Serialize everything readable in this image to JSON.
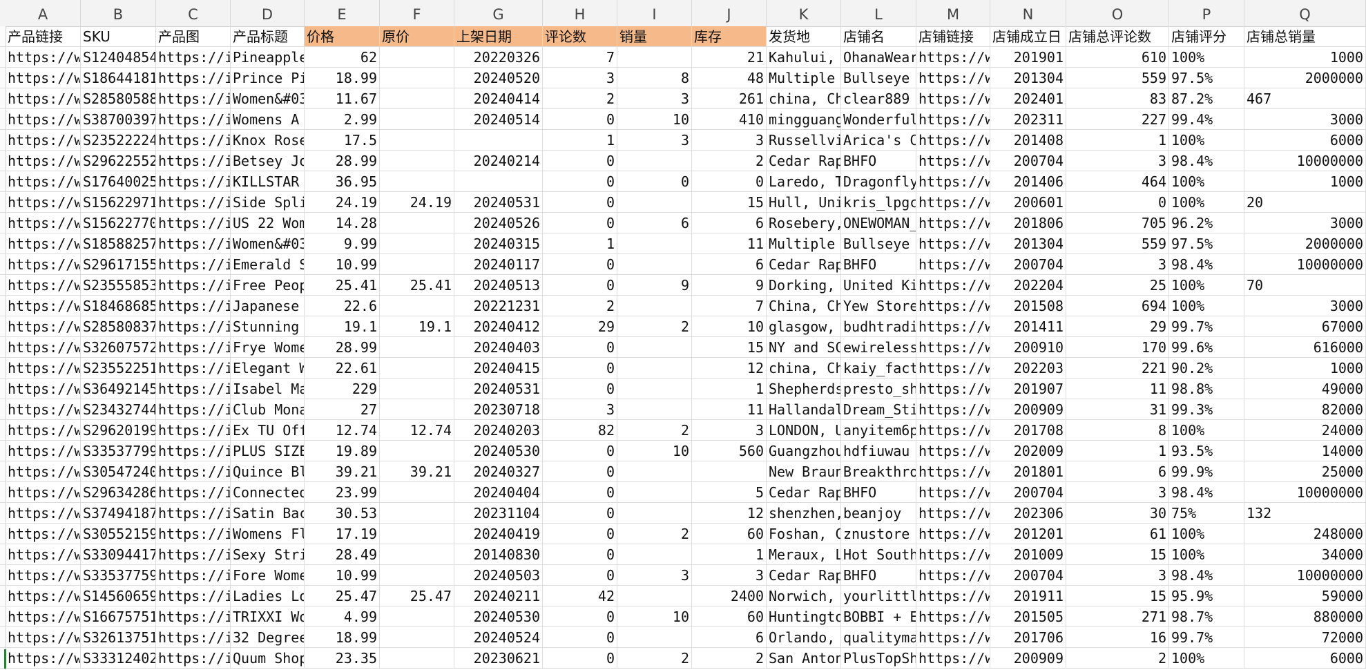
{
  "columns": [
    "A",
    "B",
    "C",
    "D",
    "E",
    "F",
    "G",
    "H",
    "I",
    "J",
    "K",
    "L",
    "M",
    "N",
    "O",
    "P",
    "Q"
  ],
  "header": [
    "产品链接",
    "SKU",
    "产品图",
    "产品标题",
    "价格",
    "原价",
    "上架日期",
    "评论数",
    "销量",
    "库存",
    "发货地",
    "店铺名",
    "店铺链接",
    "店铺成立日",
    "店铺总评论数",
    "店铺评分",
    "店铺总销量"
  ],
  "highlight_color": "#f6b98a",
  "rows": [
    [
      "https://w",
      "S12404854",
      "https://i",
      "Pineapple",
      "62",
      "",
      "20220326",
      "7",
      "",
      "21",
      "Kahului, ",
      "OhanaWear",
      "https://w",
      "201901",
      "610",
      "100%",
      "1000"
    ],
    [
      "https://w",
      "S18644181",
      "https://i",
      "Prince Pi",
      "18.99",
      "",
      "20240520",
      "3",
      "8",
      "48",
      "Multiple ",
      "Bullseye ",
      "https://w",
      "201304",
      "559",
      "97.5%",
      "2000000"
    ],
    [
      "https://w",
      "S28580588",
      "https://i",
      "Women&#03",
      "11.67",
      "",
      "20240414",
      "2",
      "3",
      "261",
      "china, Ch",
      "clear889 ",
      "https://w",
      "202401",
      "83",
      "87.2%",
      "467"
    ],
    [
      "https://w",
      "S38700397",
      "https://i",
      "Womens A ",
      "2.99",
      "",
      "20240514",
      "0",
      "10",
      "410",
      "mingguang",
      "Wonderful",
      "https://w",
      "202311",
      "227",
      "99.4%",
      "3000"
    ],
    [
      "https://w",
      "S23522224",
      "https://i",
      "Knox Rose",
      "17.5",
      "",
      "",
      "1",
      "3",
      "3",
      "Russellvi",
      "Arica's C",
      "https://w",
      "201408",
      "1",
      "100%",
      "6000"
    ],
    [
      "https://w",
      "S29622552",
      "https://i",
      "Betsey Jo",
      "28.99",
      "",
      "20240214",
      "0",
      "",
      "2",
      "Cedar Rap",
      "BHFO",
      "https://w",
      "200704",
      "3",
      "98.4%",
      "10000000"
    ],
    [
      "https://w",
      "S17640025",
      "https://i",
      "KILLSTAR ",
      "36.95",
      "",
      "",
      "0",
      "0",
      "0",
      "Laredo, T",
      "Dragonfly",
      "https://w",
      "201406",
      "464",
      "100%",
      "1000"
    ],
    [
      "https://w",
      "S15622971",
      "https://i",
      "Side Spli",
      "24.19",
      "24.19",
      "20240531",
      "0",
      "",
      "15",
      "Hull, Uni",
      "kris_lpgc",
      "https://w",
      "200601",
      "0",
      "100%",
      "20"
    ],
    [
      "https://w",
      "S15622770",
      "https://i",
      "US 22 Wom",
      "14.28",
      "",
      "20240526",
      "0",
      "6",
      "6",
      "Rosebery,",
      "ONEWOMAN_",
      "https://w",
      "201806",
      "705",
      "96.2%",
      "3000"
    ],
    [
      "https://w",
      "S18588257",
      "https://i",
      "Women&#03",
      "9.99",
      "",
      "20240315",
      "1",
      "",
      "11",
      "Multiple ",
      "Bullseye ",
      "https://w",
      "201304",
      "559",
      "97.5%",
      "2000000"
    ],
    [
      "https://w",
      "S29617155",
      "https://i",
      "Emerald S",
      "10.99",
      "",
      "20240117",
      "0",
      "",
      "6",
      "Cedar Rap",
      "BHFO",
      "https://w",
      "200704",
      "3",
      "98.4%",
      "10000000"
    ],
    [
      "https://w",
      "S23555853",
      "https://i",
      "Free Peop",
      "25.41",
      "25.41",
      "20240513",
      "0",
      "9",
      "9",
      "Dorking, ",
      "United Ki",
      "https://w",
      "202204",
      "25",
      "100%",
      "70"
    ],
    [
      "https://w",
      "S18468685",
      "https://i",
      "Japanese ",
      "22.6",
      "",
      "20221231",
      "2",
      "",
      "7",
      "China, Ch",
      "Yew Store",
      "https://w",
      "201508",
      "694",
      "100%",
      "3000"
    ],
    [
      "https://w",
      "S28580837",
      "https://i",
      "Stunning ",
      "19.1",
      "19.1",
      "20240412",
      "29",
      "2",
      "10",
      "glasgow, ",
      "budhtradi",
      "https://w",
      "201411",
      "29",
      "99.7%",
      "67000"
    ],
    [
      "https://w",
      "S32607572",
      "https://i",
      "Frye Wome",
      "28.99",
      "",
      "20240403",
      "0",
      "",
      "15",
      "NY and SC",
      "ewireless",
      "https://w",
      "200910",
      "170",
      "99.6%",
      "616000"
    ],
    [
      "https://w",
      "S23552251",
      "https://i",
      "Elegant W",
      "22.61",
      "",
      "20240415",
      "0",
      "",
      "12",
      "china, Ch",
      "kaiy_fact",
      "https://w",
      "202203",
      "221",
      "90.2%",
      "1000"
    ],
    [
      "https://w",
      "S36492145",
      "https://i",
      "Isabel Ma",
      "229",
      "",
      "20240531",
      "0",
      "",
      "1",
      "Shepherds",
      "presto_sh",
      "https://w",
      "201907",
      "11",
      "98.8%",
      "49000"
    ],
    [
      "https://w",
      "S23432744",
      "https://i",
      "Club Mona",
      "27",
      "",
      "20230718",
      "3",
      "",
      "11",
      "Hallandal",
      "Dream_Sti",
      "https://w",
      "200909",
      "31",
      "99.3%",
      "82000"
    ],
    [
      "https://w",
      "S29620199",
      "https://i",
      "Ex TU Off",
      "12.74",
      "12.74",
      "20240203",
      "82",
      "2",
      "3",
      "LONDON, U",
      "anyitem6p",
      "https://w",
      "201708",
      "8",
      "100%",
      "24000"
    ],
    [
      "https://w",
      "S33537799",
      "https://i",
      "PLUS SIZE",
      "19.89",
      "",
      "20240530",
      "0",
      "10",
      "560",
      "Guangzhou",
      "hdfiuwau ",
      "https://w",
      "202009",
      "1",
      "93.5%",
      "14000"
    ],
    [
      "https://w",
      "S30547240",
      "https://i",
      "Quince Bl",
      "39.21",
      "39.21",
      "20240327",
      "0",
      "",
      "",
      "New Braun",
      "Breakthro",
      "https://w",
      "201801",
      "6",
      "99.9%",
      "25000"
    ],
    [
      "https://w",
      "S29634286",
      "https://i",
      "Connected",
      "23.99",
      "",
      "20240404",
      "0",
      "",
      "5",
      "Cedar Rap",
      "BHFO",
      "https://w",
      "200704",
      "3",
      "98.4%",
      "10000000"
    ],
    [
      "https://w",
      "S37494187",
      "https://i",
      "Satin Bac",
      "30.53",
      "",
      "20231104",
      "0",
      "",
      "12",
      "shenzhen,",
      "beanjoy",
      "https://w",
      "202306",
      "30",
      "75%",
      "132"
    ],
    [
      "https://w",
      "S30552159",
      "https://i",
      "Womens Fl",
      "17.19",
      "",
      "20240419",
      "0",
      "2",
      "60",
      "Foshan, C",
      "znustore ",
      "https://w",
      "201201",
      "61",
      "100%",
      "248000"
    ],
    [
      "https://w",
      "S33094417",
      "https://i",
      "Sexy Stri",
      "28.49",
      "",
      "20140830",
      "0",
      "",
      "1",
      "Meraux, L",
      "Hot South",
      "https://w",
      "201009",
      "15",
      "100%",
      "34000"
    ],
    [
      "https://w",
      "S33537759",
      "https://i",
      "Fore Wome",
      "10.99",
      "",
      "20240503",
      "0",
      "3",
      "3",
      "Cedar Rap",
      "BHFO",
      "https://w",
      "200704",
      "3",
      "98.4%",
      "10000000"
    ],
    [
      "https://w",
      "S14560659",
      "https://i",
      "Ladies Lo",
      "25.47",
      "25.47",
      "20240211",
      "42",
      "",
      "2400",
      "Norwich, ",
      "yourlittl",
      "https://w",
      "201911",
      "15",
      "95.9%",
      "59000"
    ],
    [
      "https://w",
      "S16675751",
      "https://i",
      "TRIXXI Wo",
      "4.99",
      "",
      "20240530",
      "0",
      "10",
      "60",
      "Huntingto",
      "BOBBI + E",
      "https://w",
      "201505",
      "271",
      "98.7%",
      "880000"
    ],
    [
      "https://w",
      "S32613751",
      "https://i",
      "32 Degree",
      "18.99",
      "",
      "20240524",
      "0",
      "",
      "6",
      "Orlando, ",
      "qualityma",
      "https://w",
      "201706",
      "16",
      "99.7%",
      "72000"
    ],
    [
      "https://w",
      "S33312402",
      "https://i",
      "Quum Shop",
      "23.35",
      "",
      "20230621",
      "0",
      "2",
      "2",
      "San Anton",
      "PlusTopSh",
      "https://w",
      "200909",
      "2",
      "100%",
      "6000"
    ]
  ]
}
